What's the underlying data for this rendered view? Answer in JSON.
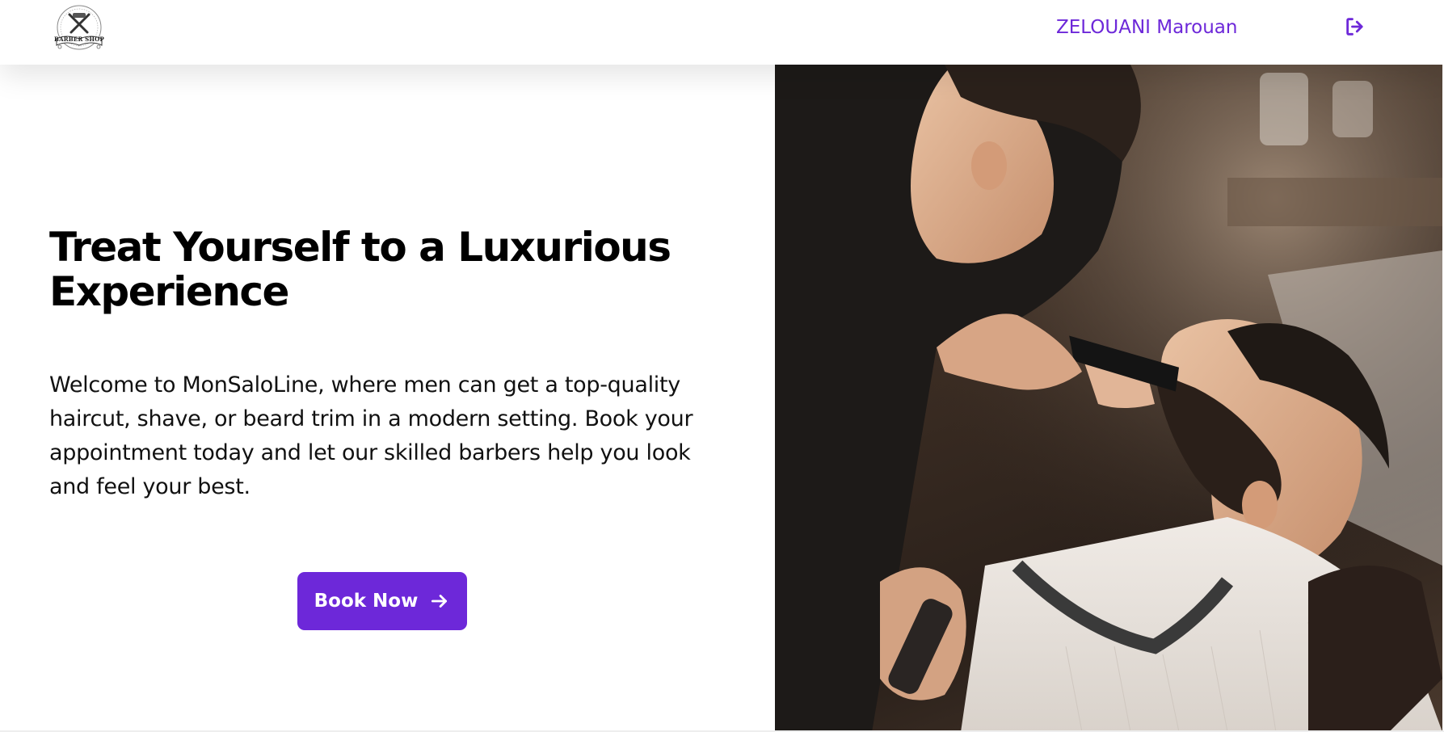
{
  "header": {
    "logo_text": "BARBER SHOP",
    "user_name": "ZELOUANI Marouan",
    "logout_icon": "logout-icon",
    "accent_color": "#6d28d9"
  },
  "hero": {
    "headline": "Treat Yourself to a Luxurious Experience",
    "intro": "Welcome to MonSaloLine, where men can get a top-quality haircut, shave, or beard trim in a modern setting. Book your appointment today and let our skilled barbers help you look and feel your best.",
    "cta_label": "Book Now",
    "cta_icon": "arrow-right-icon",
    "image_subject": "barber-trimming-beard-photo"
  }
}
